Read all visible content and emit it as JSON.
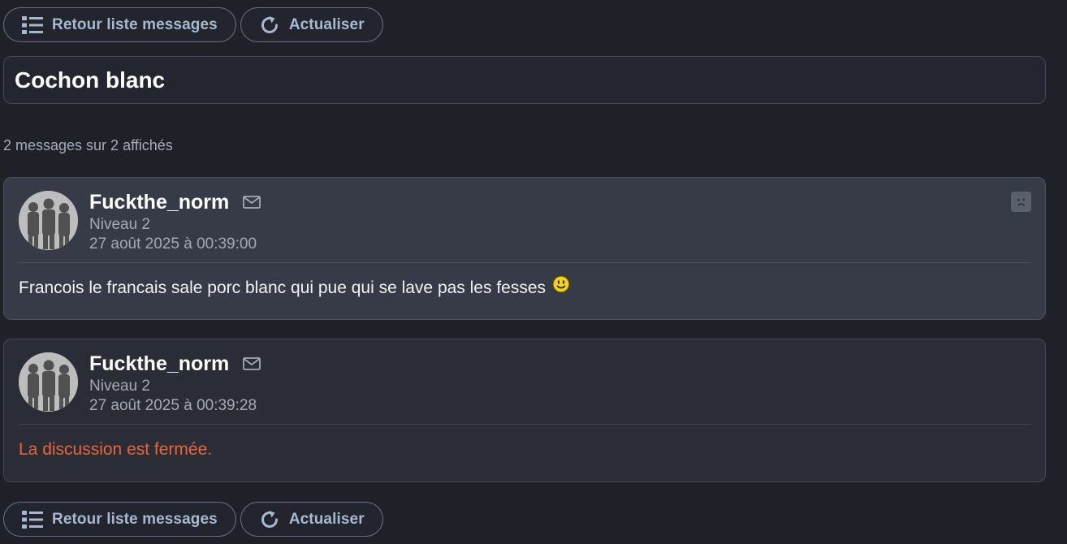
{
  "toolbar": {
    "back_label": "Retour liste messages",
    "back_icon": "list-icon",
    "refresh_label": "Actualiser",
    "refresh_icon": "refresh-icon"
  },
  "topic": {
    "title": "Cochon blanc",
    "count_text": "2 messages sur 2 affichés"
  },
  "posts": [
    {
      "author": "Fuckthe_norm",
      "level": "Niveau 2",
      "date": "27 août 2025 à 00:39:00",
      "text": "Francois le francais sale porc blanc qui pue qui se lave pas les fesses",
      "emoji": "smiley-icon"
    },
    {
      "author": "Fuckthe_norm",
      "level": "Niveau 2",
      "date": "27 août 2025 à 00:39:28",
      "text": "La discussion est fermée."
    }
  ],
  "colors": {
    "background": "#1f2128",
    "button_text": "#a9b8cf",
    "closed_text": "#e8643b",
    "highlight_post": "#363b47"
  }
}
